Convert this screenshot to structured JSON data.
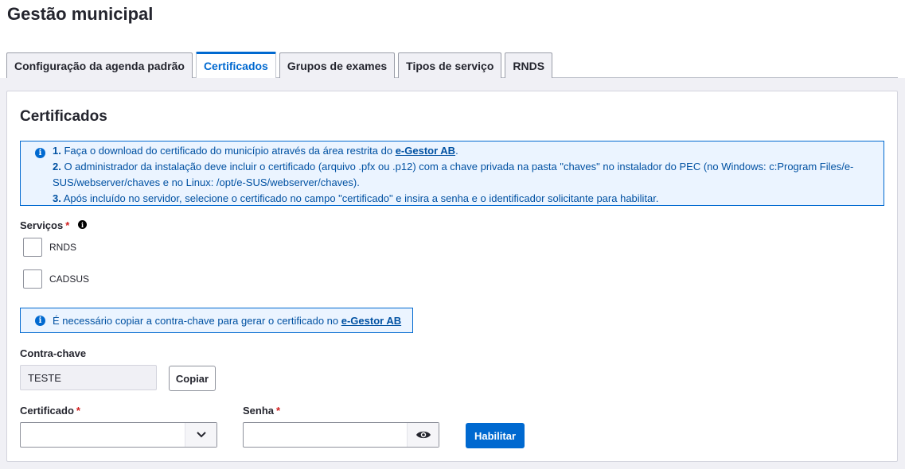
{
  "page": {
    "title": "Gestão municipal"
  },
  "tabs": [
    {
      "label": "Configuração da agenda padrão"
    },
    {
      "label": "Certificados"
    },
    {
      "label": "Grupos de exames"
    },
    {
      "label": "Tipos de serviço"
    },
    {
      "label": "RNDS"
    }
  ],
  "active_tab": "Certificados",
  "card": {
    "title": "Certificados",
    "info": {
      "line1_num": "1.",
      "line1_text": " Faça o download do certificado do município através da área restrita do ",
      "line1_link": "e-Gestor AB",
      "line1_end": ".",
      "line2_num": "2.",
      "line2_text": " O administrador da instalação deve incluir o certificado (arquivo .pfx ou .p12) com a chave privada na pasta \"chaves\" no instalador do PEC (no Windows: c:Program Files/e-SUS/webserver/chaves e no Linux: /opt/e-SUS/webserver/chaves).",
      "line3_num": "3.",
      "line3_text": " Após incluído no servidor, selecione o certificado no campo \"certificado\" e insira a senha e o identificador solicitante para habilitar."
    },
    "servicos": {
      "label": "Serviços",
      "required": "*",
      "help_icon": "info-circle-icon",
      "options": [
        {
          "label": "RNDS",
          "checked": false
        },
        {
          "label": "CADSUS",
          "checked": false
        }
      ]
    },
    "contra_info": {
      "text": "É necessário copiar a contra-chave para gerar o certificado no ",
      "link": "e-Gestor AB"
    },
    "contra_chave": {
      "label": "Contra-chave",
      "value": "TESTE",
      "copy_button": "Copiar"
    },
    "certificado": {
      "label": "Certificado",
      "required": "*",
      "value": "",
      "icon": "chevron-down-icon"
    },
    "senha": {
      "label": "Senha",
      "required": "*",
      "value": "",
      "icon": "eye-icon"
    },
    "submit_button": "Habilitar"
  },
  "colors": {
    "primary": "#0069d0",
    "info_bg": "#ebf4ff",
    "required": "#d01e1e",
    "page_bg": "#f0f0f5"
  }
}
